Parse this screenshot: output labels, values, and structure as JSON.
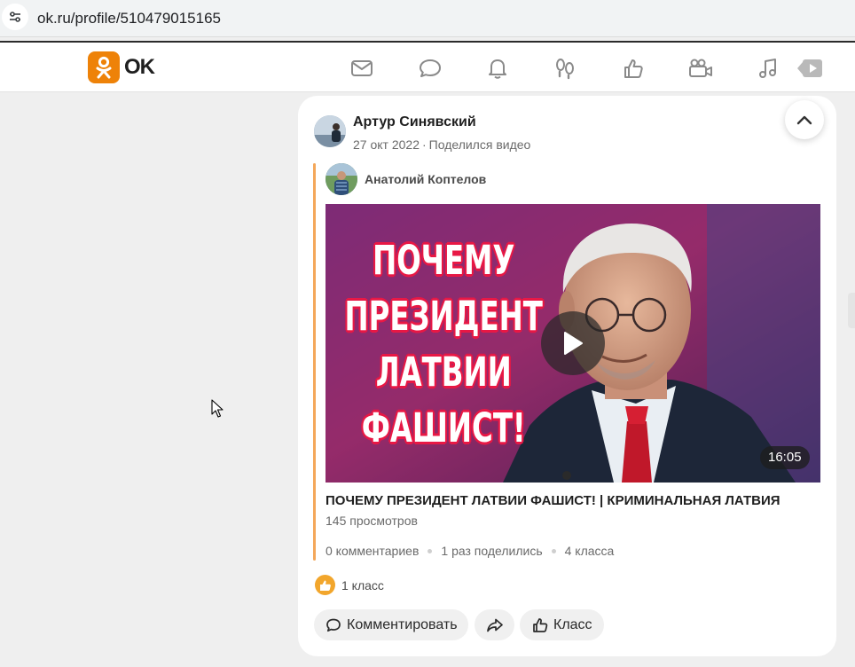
{
  "browser": {
    "url": "ok.ru/profile/510479015165"
  },
  "nav": {
    "logo_text": "OK",
    "brand_color": "#ee8208",
    "icons": [
      "messages-icon",
      "discussions-icon",
      "notifications-icon",
      "guests-icon",
      "marks-icon",
      "video-icon",
      "music-icon",
      "video-player-icon"
    ]
  },
  "post": {
    "author": "Артур Синявский",
    "date": "27 окт 2022",
    "action": "Поделился видео",
    "original_author": "Анатолий Коптелов",
    "video": {
      "thumbnail_lines": [
        "ПОЧЕМУ",
        "ПРЕЗИДЕНТ",
        "ЛАТВИИ",
        "ФАШИСТ!"
      ],
      "duration": "16:05",
      "title": "ПОЧЕМУ ПРЕЗИДЕНТ ЛАТВИИ ФАШИСТ! | КРИМИНАЛЬНАЯ ЛАТВИЯ",
      "views": "145 просмотров"
    },
    "stats": {
      "comments": "0 комментариев",
      "shares": "1 раз поделились",
      "classes": "4 класса"
    },
    "likes_text": "1 класс",
    "buttons": {
      "comment": "Комментировать",
      "like": "Класс"
    }
  }
}
